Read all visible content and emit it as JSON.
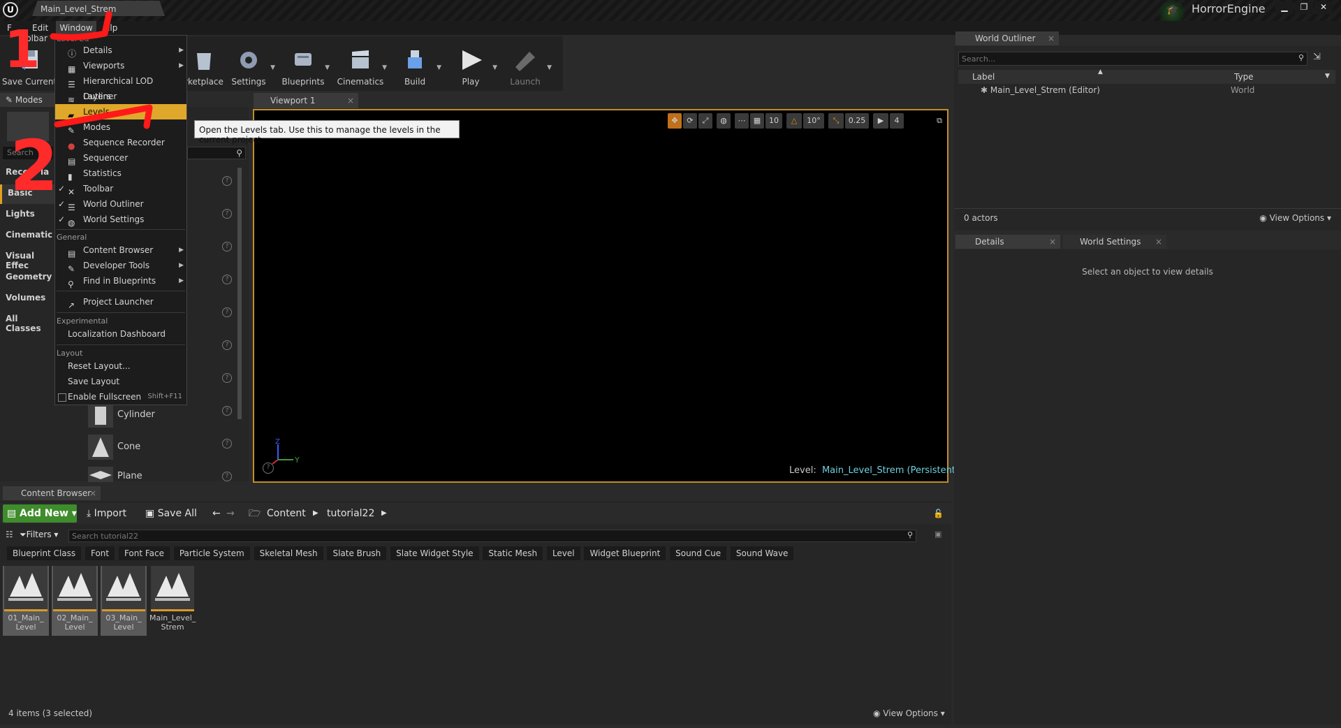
{
  "colors": {
    "accent": "#e0a82a",
    "addnew": "#3e8c2b",
    "viewport_border": "#c18e2b",
    "level_name": "#6fd1e0",
    "annotation": "#ff1a1a"
  },
  "titlebar": {
    "doc_tab": "Main_Level_Strem",
    "project": "HorrorEngine",
    "logo_icon": "unreal-logo-icon",
    "win_min": "▁",
    "win_restore": "❐",
    "win_close": "✕"
  },
  "menubar": {
    "file": "F",
    "edit": "Edit",
    "window": "Window",
    "help": "elp"
  },
  "toolbar": {
    "tab": "oolbar",
    "buttons": [
      {
        "label": "Save Current"
      },
      {
        "label": "rketplace"
      },
      {
        "label": "Settings"
      },
      {
        "label": "Blueprints"
      },
      {
        "label": "Cinematics"
      },
      {
        "label": "Build"
      },
      {
        "label": "Play"
      },
      {
        "label": "Launch"
      }
    ]
  },
  "modes": {
    "tab": "Modes",
    "search_placeholder": "Search",
    "categories": [
      "Recen",
      "Basic",
      "Lights",
      "Cinematic",
      "Visual Effec",
      "Geometry",
      "Volumes",
      "All Classes"
    ],
    "recent_suffix": "Pla",
    "shapes": [
      "Cylinder",
      "Cone",
      "Plane"
    ]
  },
  "window_menu": {
    "items": [
      {
        "label": "Details",
        "submenu": true,
        "checked": false
      },
      {
        "label": "Viewports",
        "submenu": true,
        "checked": false
      },
      {
        "label": "Hierarchical LOD Outliner",
        "submenu": false,
        "checked": false
      },
      {
        "label": "Layers",
        "submenu": false,
        "checked": false
      },
      {
        "label": "Levels",
        "submenu": false,
        "checked": false
      },
      {
        "label": "Modes",
        "submenu": false,
        "checked": false
      },
      {
        "label": "Sequence Recorder",
        "submenu": false,
        "checked": false
      },
      {
        "label": "Sequencer",
        "submenu": false,
        "checked": false
      },
      {
        "label": "Statistics",
        "submenu": false,
        "checked": false
      },
      {
        "label": "Toolbar",
        "submenu": false,
        "checked": true
      },
      {
        "label": "World Outliner",
        "submenu": false,
        "checked": true
      },
      {
        "label": "World Settings",
        "submenu": false,
        "checked": true
      }
    ],
    "general_header": "General",
    "general": [
      {
        "label": "Content Browser",
        "submenu": true
      },
      {
        "label": "Developer Tools",
        "submenu": true
      },
      {
        "label": "Find in Blueprints",
        "submenu": true
      },
      {
        "label": "Project Launcher",
        "submenu": false
      }
    ],
    "experimental_header": "Experimental",
    "experimental": [
      {
        "label": "Localization Dashboard"
      }
    ],
    "layout_header": "Layout",
    "layout": [
      {
        "label": "Reset Layout..."
      },
      {
        "label": "Save Layout"
      }
    ],
    "fullscreen": {
      "label": "Enable Fullscreen",
      "shortcut": "Shift+F11"
    },
    "partial_header": "Level Ed"
  },
  "tooltip": "Open the Levels tab. Use this to manage the levels in the current project.",
  "viewport": {
    "tab": "Viewport 1",
    "tools": [
      "10",
      "10°",
      "0.25",
      "4"
    ],
    "level_prefix": "Level:",
    "level_name": "Main_Level_Strem (Persistent)",
    "axis_y": "Y",
    "axis_z": "Z"
  },
  "outliner": {
    "tab": "World Outliner",
    "search_placeholder": "Search...",
    "col_label": "Label",
    "col_type": "Type",
    "row_label": "Main_Level_Strem (Editor)",
    "row_type": "World",
    "actors": "0 actors",
    "view_options": "View Options"
  },
  "details": {
    "tab": "Details",
    "world_settings_tab": "World Settings",
    "empty_message": "Select an object to view details"
  },
  "content_browser": {
    "tab": "Content Browser",
    "add_new": "Add New",
    "import": "Import",
    "save_all": "Save All",
    "path": [
      "Content",
      "tutorial22"
    ],
    "filters": "Filters",
    "search_placeholder": "Search tutorial22",
    "chips": [
      "Blueprint Class",
      "Font",
      "Font Face",
      "Particle System",
      "Skeletal Mesh",
      "Slate Brush",
      "Slate Widget Style",
      "Static Mesh",
      "Level",
      "Widget Blueprint",
      "Sound Cue",
      "Sound Wave"
    ],
    "assets": [
      {
        "line1": "01_Main_",
        "line2": "Level",
        "selected": true
      },
      {
        "line1": "02_Main_",
        "line2": "Level",
        "selected": true
      },
      {
        "line1": "03_Main_",
        "line2": "Level",
        "selected": true
      },
      {
        "line1": "Main_Level_",
        "line2": "Strem",
        "selected": false
      }
    ],
    "status": "4 items (3 selected)",
    "view_options": "View Options"
  },
  "annotations": {
    "step1": "1",
    "step2": "2"
  }
}
